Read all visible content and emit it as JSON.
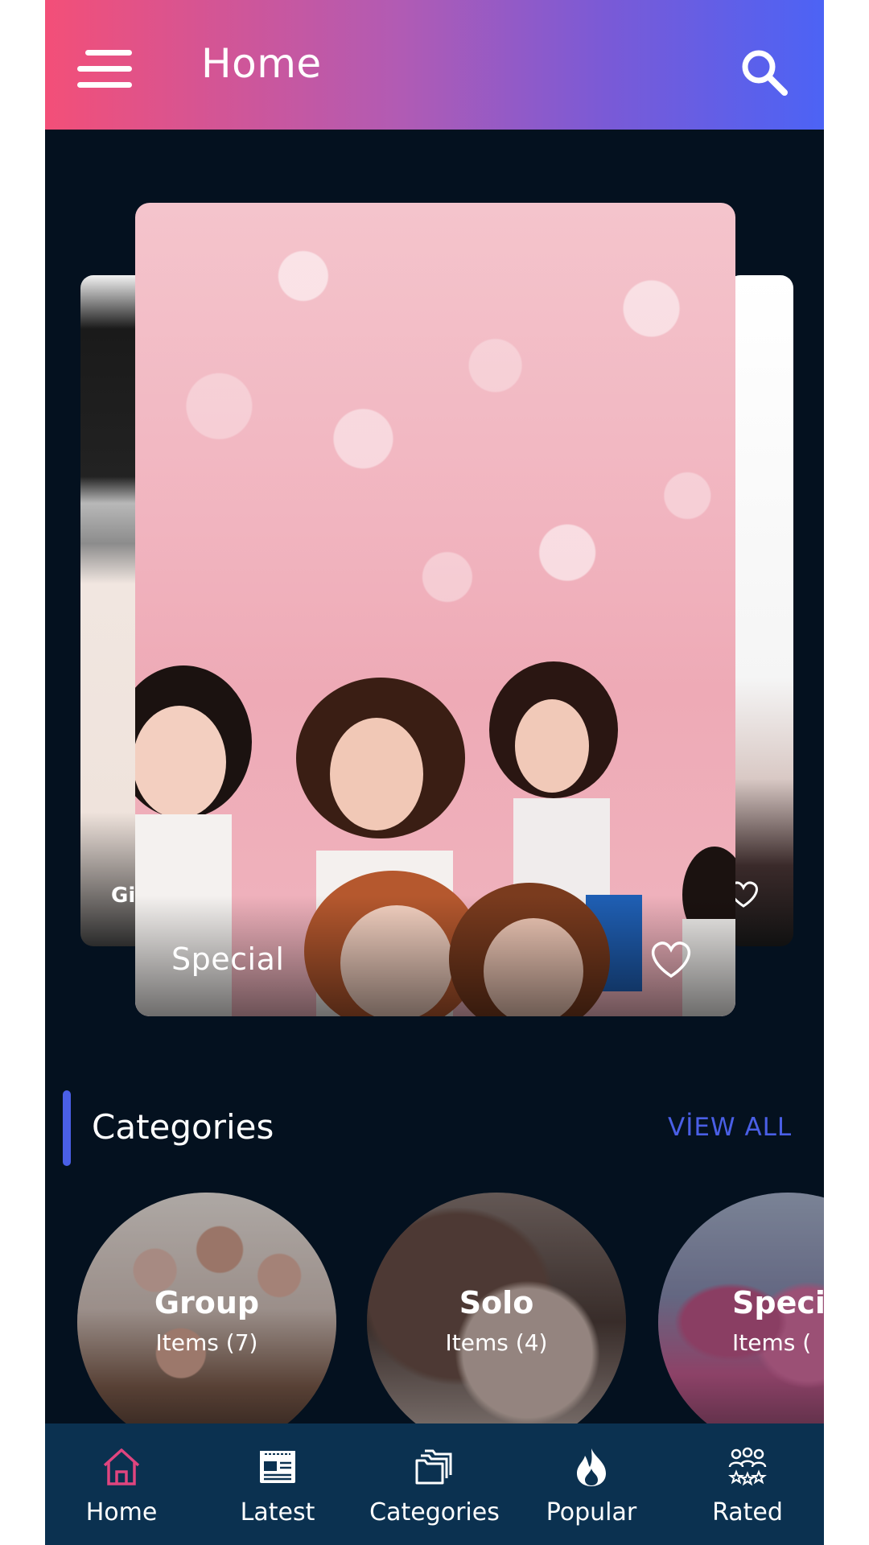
{
  "header": {
    "title": "Home",
    "menu_icon": "hamburger-menu-icon",
    "search_icon": "search-icon",
    "gradient": [
      "#f34f78",
      "#4c63f5"
    ]
  },
  "slider": {
    "cards": [
      {
        "title": "Gi",
        "position": "previous"
      },
      {
        "title": "Special",
        "position": "current",
        "favorite_icon": "heart-outline-icon"
      },
      {
        "title": "",
        "position": "next"
      }
    ]
  },
  "categories": {
    "title": "Categories",
    "view_all": "VİEW ALL",
    "accent_color": "#4a5fe6",
    "items": [
      {
        "name": "Group",
        "count_label": "Items (7)"
      },
      {
        "name": "Solo",
        "count_label": "Items (4)"
      },
      {
        "name": "Speci",
        "count_label": "Items ("
      }
    ]
  },
  "bottom_nav": {
    "active_color": "#e0457f",
    "items": [
      {
        "label": "Home",
        "icon": "home-icon",
        "active": true
      },
      {
        "label": "Latest",
        "icon": "newspaper-icon",
        "active": false
      },
      {
        "label": "Categories",
        "icon": "folders-icon",
        "active": false
      },
      {
        "label": "Popular",
        "icon": "flame-icon",
        "active": false
      },
      {
        "label": "Rated",
        "icon": "users-stars-icon",
        "active": false
      }
    ]
  }
}
